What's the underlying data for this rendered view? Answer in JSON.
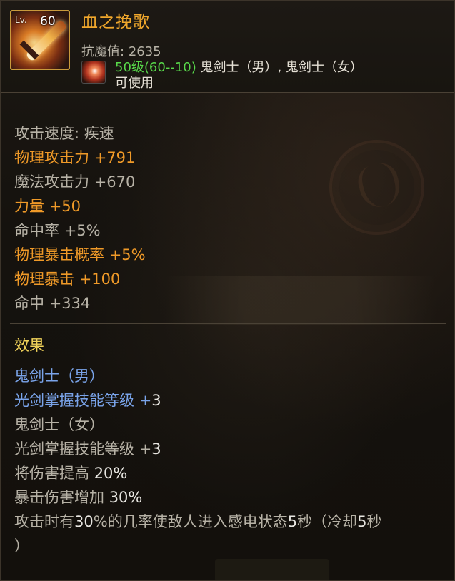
{
  "header": {
    "lv_label": "Lv.",
    "level": "60",
    "title": "血之挽歌",
    "stat_label": "抗魔值:",
    "stat_value": "2635",
    "req_level": "50级(60--10)",
    "req_classes": "鬼剑士（男）, 鬼剑士（女）",
    "usable": "可使用",
    "icon": "sword-icon",
    "class_icon": "class-emblem-icon"
  },
  "stats": [
    {
      "label": "攻击速度: 疾速",
      "value": ""
    },
    {
      "label": "物理攻击力",
      "value": "+791"
    },
    {
      "label": "魔法攻击力",
      "value": "+670"
    },
    {
      "label": "力量",
      "value": "+50"
    },
    {
      "label": "命中率",
      "value": "+5%"
    },
    {
      "label": "物理暴击概率",
      "value": "+5%"
    },
    {
      "label": "物理暴击",
      "value": "+100"
    },
    {
      "label": "命中",
      "value": "+334"
    }
  ],
  "effects": {
    "heading": "效果",
    "male_class": "鬼剑士（男）",
    "male_skill": "光剑掌握技能等级",
    "male_skill_value": "3",
    "female_class": "鬼剑士（女）",
    "female_skill": "光剑掌握技能等级",
    "female_skill_value": "3",
    "damage_label": "将伤害提高",
    "damage_value": "20%",
    "crit_label": "暴击伤害增加",
    "crit_value": "30%",
    "proc_prefix": "攻击时有",
    "proc_chance": "30",
    "proc_mid": "%的几率使敌人进入感电状态",
    "proc_duration": "5",
    "proc_sec": "秒（冷却",
    "proc_cooldown": "5",
    "proc_end": "秒",
    "proc_close": "）"
  },
  "colors": {
    "title": "#f0a72c",
    "highlight_stat": "#f09a28",
    "normal_text": "#b7b2a6",
    "class_text": "#7aa4ea",
    "heading": "#f0d25a",
    "requirement_level": "#58d84a"
  }
}
